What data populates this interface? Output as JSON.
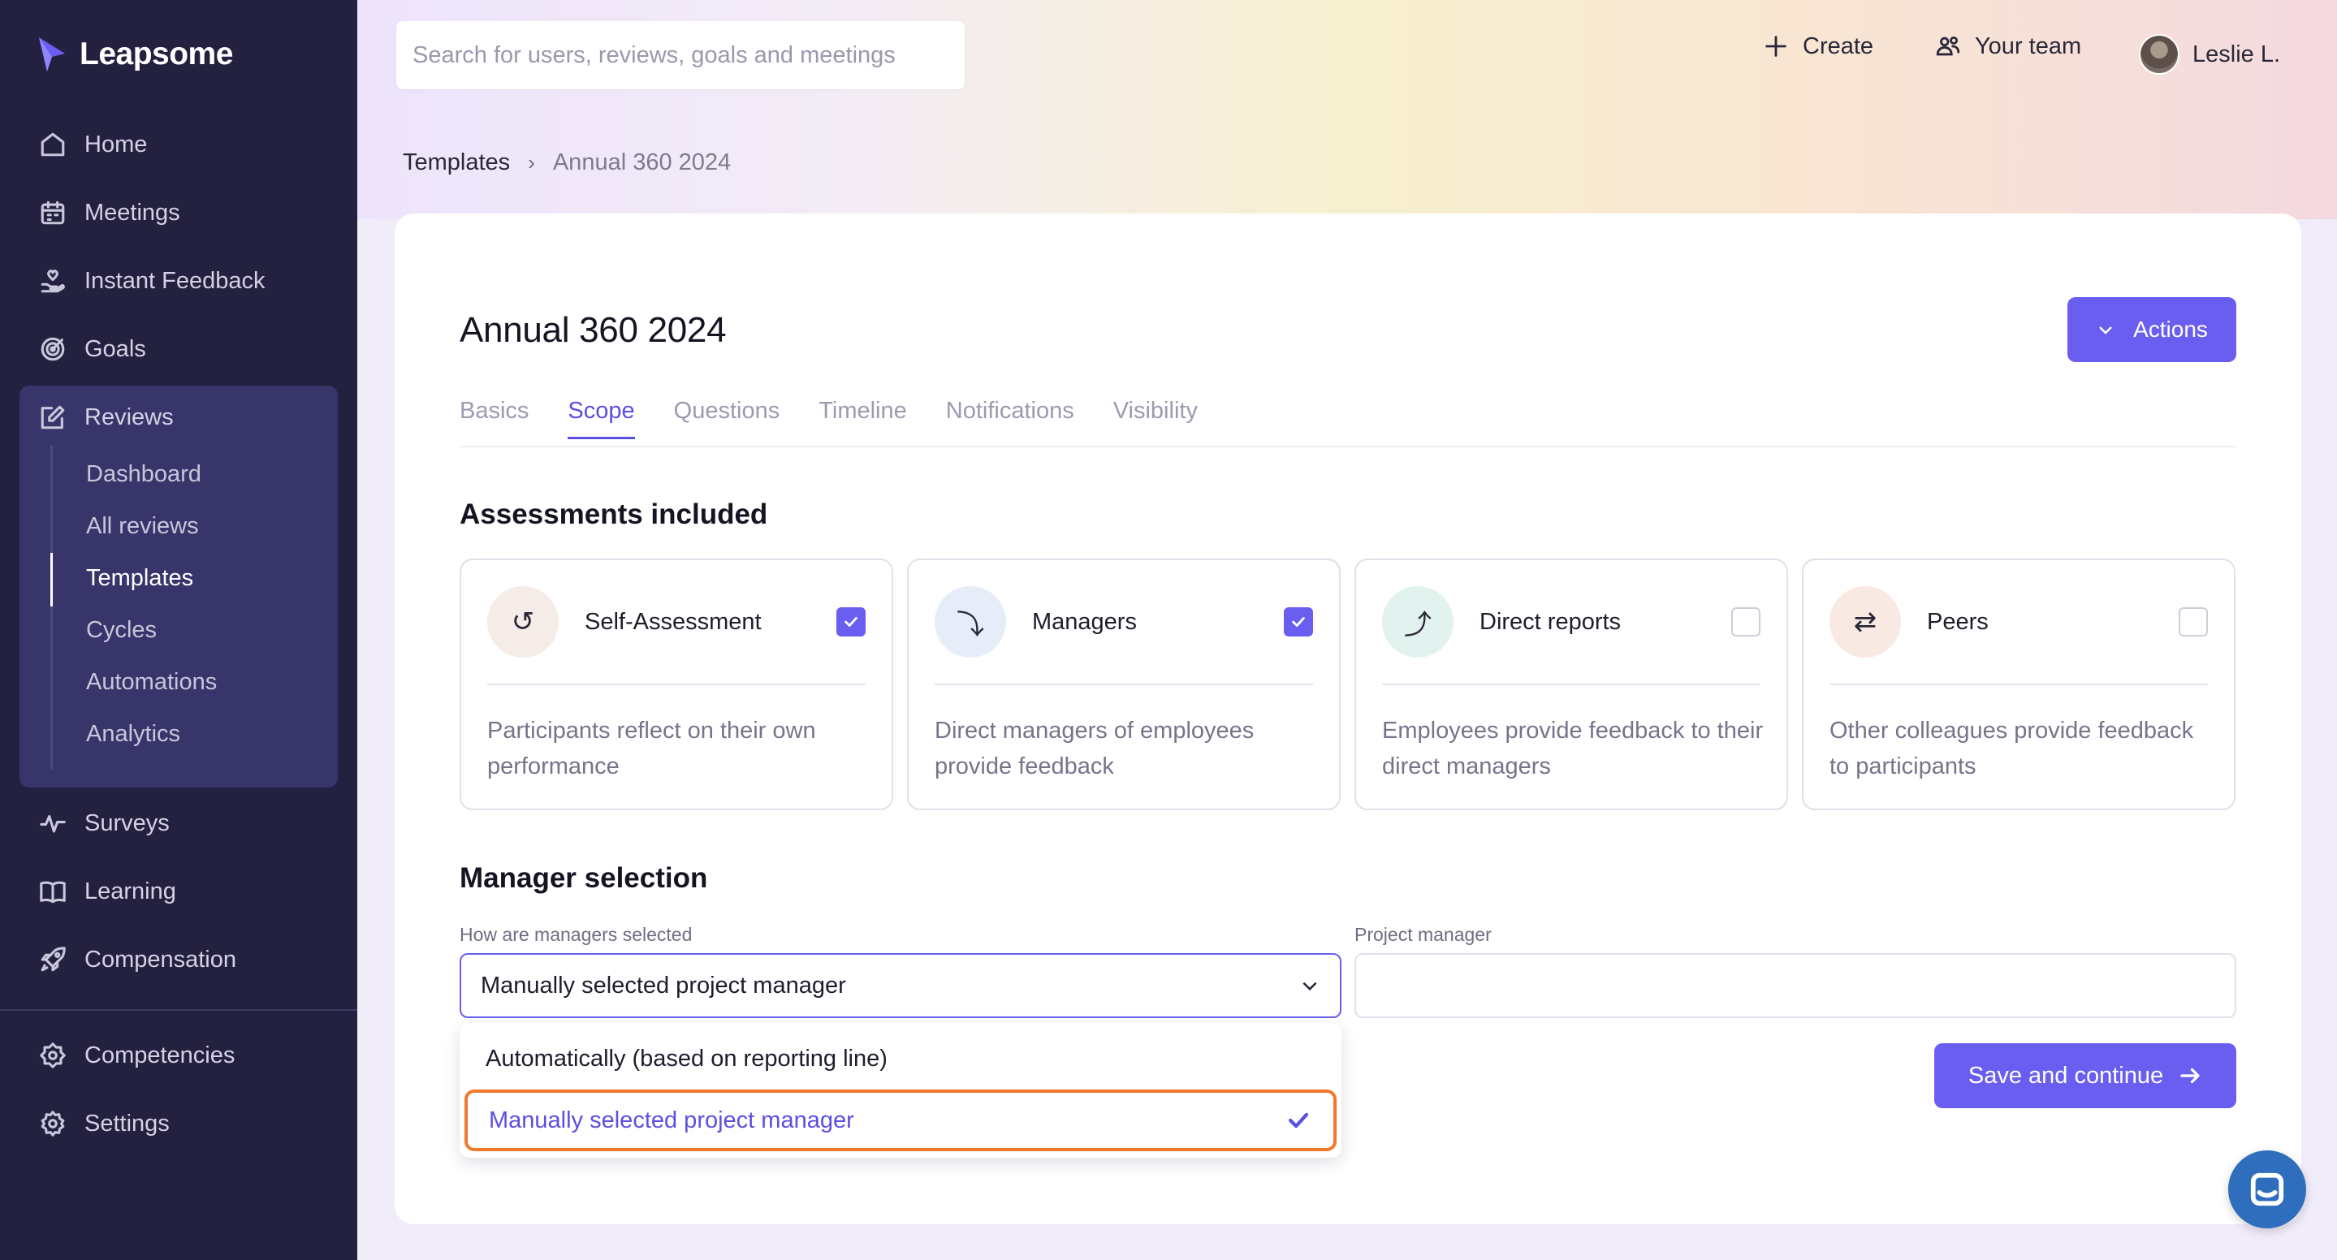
{
  "app": {
    "name": "Leapsome"
  },
  "sidebar": {
    "items": [
      {
        "label": "Home",
        "icon": "home-icon"
      },
      {
        "label": "Meetings",
        "icon": "calendar-icon"
      },
      {
        "label": "Instant Feedback",
        "icon": "hand-heart-icon"
      },
      {
        "label": "Goals",
        "icon": "target-icon"
      },
      {
        "label": "Reviews",
        "icon": "edit-icon"
      },
      {
        "label": "Surveys",
        "icon": "pulse-icon"
      },
      {
        "label": "Learning",
        "icon": "book-icon"
      },
      {
        "label": "Compensation",
        "icon": "rocket-icon"
      },
      {
        "label": "Competencies",
        "icon": "badge-icon"
      },
      {
        "label": "Settings",
        "icon": "gear-icon"
      }
    ],
    "reviews_sub": [
      "Dashboard",
      "All reviews",
      "Templates",
      "Cycles",
      "Automations",
      "Analytics"
    ],
    "active_sub": "Templates"
  },
  "header": {
    "search_placeholder": "Search for users, reviews, goals and meetings",
    "create_label": "Create",
    "team_label": "Your team",
    "user_name": "Leslie L."
  },
  "breadcrumb": {
    "parent": "Templates",
    "current": "Annual 360 2024"
  },
  "page": {
    "title": "Annual 360 2024",
    "actions_label": "Actions",
    "tabs": [
      "Basics",
      "Scope",
      "Questions",
      "Timeline",
      "Notifications",
      "Visibility"
    ],
    "active_tab": "Scope"
  },
  "assessments": {
    "title": "Assessments included",
    "items": [
      {
        "name": "Self-Assessment",
        "desc": "Participants reflect on their own performance",
        "checked": true,
        "icon_glyph": "↺",
        "icon_bg": "#f5ece8"
      },
      {
        "name": "Managers",
        "desc": "Direct managers of employees provide feedback",
        "checked": true,
        "icon_glyph": "⤵",
        "icon_bg": "#e7edf8"
      },
      {
        "name": "Direct reports",
        "desc": "Employees provide feedback to their direct managers",
        "checked": false,
        "icon_glyph": "⤴",
        "icon_bg": "#e2f2ee"
      },
      {
        "name": "Peers",
        "desc": "Other colleagues provide feedback to participants",
        "checked": false,
        "icon_glyph": "⇄",
        "icon_bg": "#f8e9e2"
      }
    ]
  },
  "manager_selection": {
    "title": "Manager selection",
    "select_label": "How are managers selected",
    "select_value": "Manually selected project manager",
    "pm_label": "Project manager",
    "pm_value": "",
    "options": [
      "Automatically (based on reporting line)",
      "Manually selected project manager"
    ]
  },
  "save_label": "Save and continue",
  "colors": {
    "accent": "#6a5ef0",
    "sidebar": "#23213f",
    "highlight": "#f0792c"
  }
}
